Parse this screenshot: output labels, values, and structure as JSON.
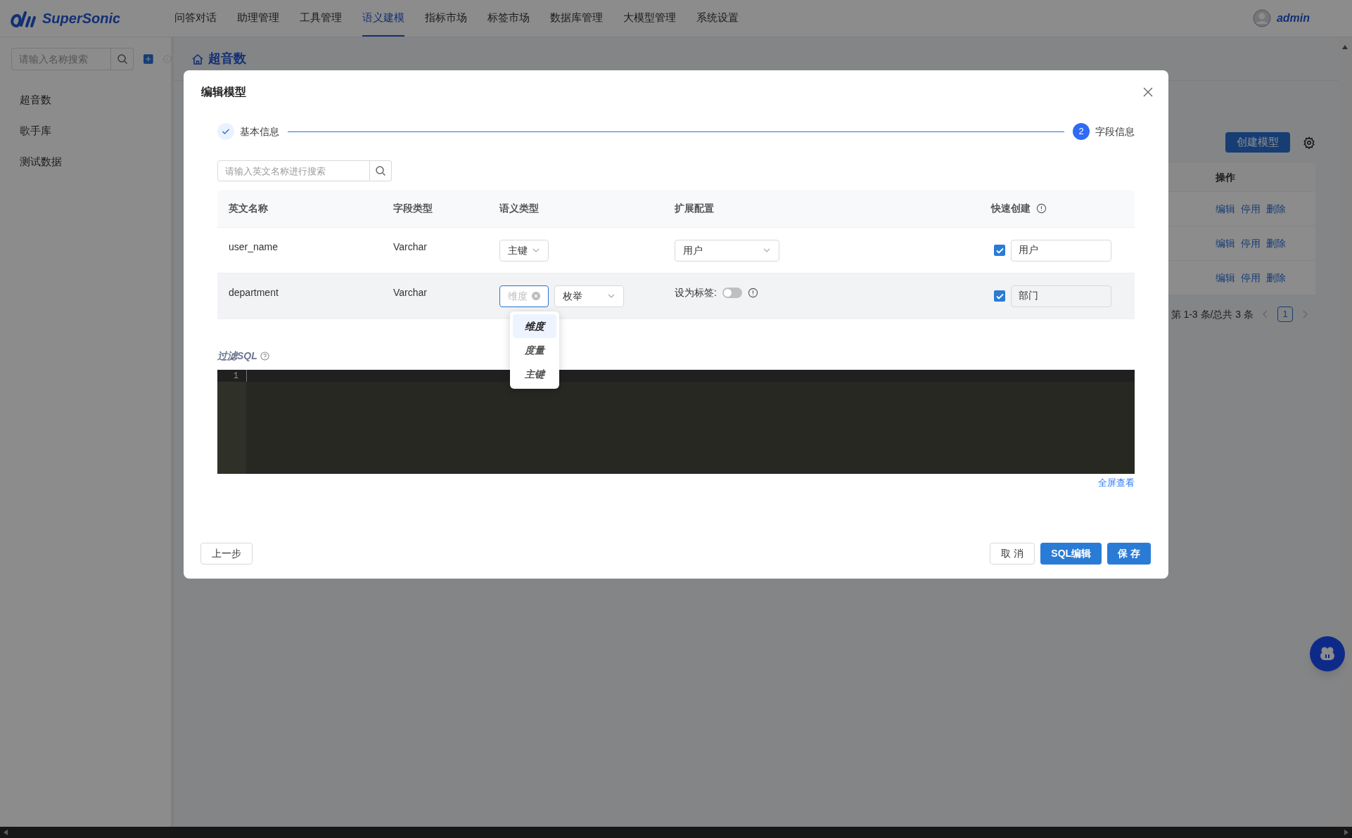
{
  "nav": {
    "logo": "SuperSonic",
    "items": [
      {
        "label": "问答对话",
        "selected": false
      },
      {
        "label": "助理管理",
        "selected": false
      },
      {
        "label": "工具管理",
        "selected": false
      },
      {
        "label": "语义建模",
        "selected": true
      },
      {
        "label": "指标市场",
        "selected": false
      },
      {
        "label": "标签市场",
        "selected": false
      },
      {
        "label": "数据库管理",
        "selected": false
      },
      {
        "label": "大模型管理",
        "selected": false
      },
      {
        "label": "系统设置",
        "selected": false
      }
    ],
    "user": "admin"
  },
  "sidebar": {
    "search": {
      "placeholder": "请输入名称搜索"
    },
    "items": [
      {
        "label": "超音数"
      },
      {
        "label": "歌手库"
      },
      {
        "label": "测试数据"
      }
    ]
  },
  "breadcrumb": "超音数",
  "toolbar": {
    "create_button": "创建模型"
  },
  "table": {
    "columns": [
      "操作"
    ],
    "rows": [
      {
        "actions": [
          "编辑",
          "停用",
          "删除"
        ]
      },
      {
        "actions": [
          "编辑",
          "停用",
          "删除"
        ]
      },
      {
        "actions": [
          "编辑",
          "停用",
          "删除"
        ]
      }
    ]
  },
  "pagination": {
    "summary": "第 1-3 条/总共 3 条",
    "pages": [
      {
        "label": "1",
        "selected": true
      }
    ]
  },
  "modal": {
    "title": "编辑模型",
    "steps": [
      {
        "label": "基本信息",
        "completed": true
      },
      {
        "label": "字段信息",
        "number": "2",
        "completed": false
      }
    ],
    "search": {
      "placeholder": "请输入英文名称进行搜索"
    },
    "columns": [
      {
        "label": "英文名称",
        "info": false
      },
      {
        "label": "字段类型",
        "info": false
      },
      {
        "label": "语义类型",
        "info": false
      },
      {
        "label": "扩展配置",
        "info": false
      },
      {
        "label": "快速创建",
        "info": true
      }
    ],
    "rows": [
      {
        "name": "user_name",
        "field_type": "Varchar",
        "hovered": false,
        "semantic": [
          {
            "value": "主键",
            "focused": false
          }
        ],
        "extension": {
          "kind": "select",
          "value": "用户"
        },
        "quick_create": {
          "checked": true,
          "value": "用户"
        }
      },
      {
        "name": "department",
        "field_type": "Varchar",
        "hovered": true,
        "semantic": [
          {
            "placeholder": "维度",
            "focused": true
          },
          {
            "value": "枚举",
            "focused": false
          }
        ],
        "extension": {
          "kind": "toggle",
          "label": "设为标签:",
          "on": false
        },
        "quick_create": {
          "checked": true,
          "value": "部门"
        }
      }
    ],
    "dropdown": {
      "options": [
        {
          "label": "维度",
          "selected": true
        },
        {
          "label": "度量",
          "selected": false
        },
        {
          "label": "主键",
          "selected": false
        }
      ]
    },
    "filter_sql": {
      "label": "过滤SQL",
      "line_numbers": [
        "1"
      ],
      "fullscreen_link": "全屏查看"
    },
    "back_button": "上一步",
    "buttons": [
      {
        "label": "取 消",
        "kind": "default"
      },
      {
        "label": "SQL编辑",
        "kind": "primary"
      },
      {
        "label": "保 存",
        "kind": "primary"
      }
    ]
  }
}
